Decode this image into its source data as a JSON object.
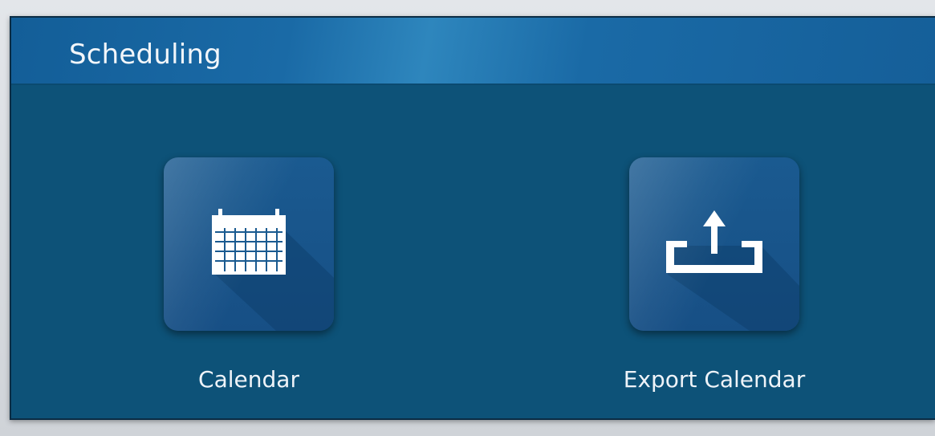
{
  "header": {
    "title": "Scheduling"
  },
  "tiles": [
    {
      "label": "Calendar",
      "icon": "calendar-icon"
    },
    {
      "label": "Export Calendar",
      "icon": "export-icon"
    }
  ],
  "colors": {
    "panel_bg": "#0d5278",
    "header_bg": "#1a6aa6",
    "tile_bg": "#174f85",
    "icon_fg": "#ffffff"
  }
}
